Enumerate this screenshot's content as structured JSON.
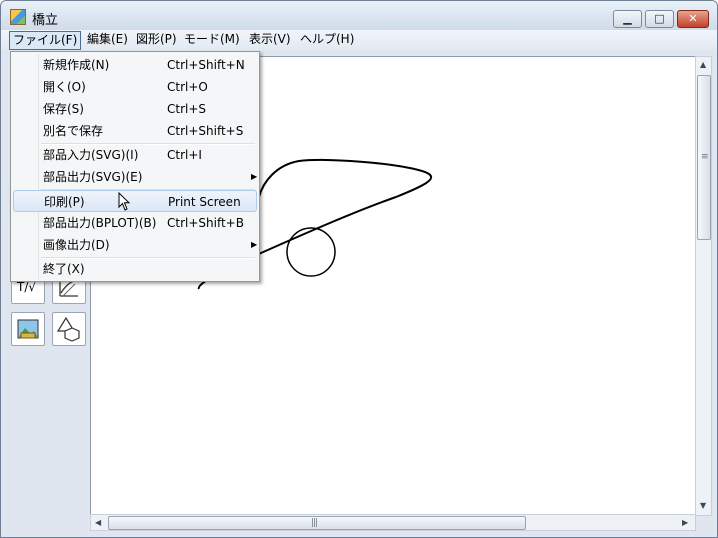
{
  "window": {
    "title": "橋立",
    "controls": {
      "minimize": "▁",
      "maximize": "□",
      "close": "✕"
    }
  },
  "menubar": [
    {
      "label": "ファイル(F)"
    },
    {
      "label": "編集(E)"
    },
    {
      "label": "図形(P)"
    },
    {
      "label": "モード(M)"
    },
    {
      "label": "表示(V)"
    },
    {
      "label": "ヘルプ(H)"
    }
  ],
  "file_menu": {
    "items": [
      {
        "label": "新規作成(N)",
        "shortcut": "Ctrl+Shift+N"
      },
      {
        "label": "開く(O)",
        "shortcut": "Ctrl+O"
      },
      {
        "label": "保存(S)",
        "shortcut": "Ctrl+S"
      },
      {
        "label": "別名で保存",
        "shortcut": "Ctrl+Shift+S"
      },
      {
        "label": "部品入力(SVG)(I)",
        "shortcut": "Ctrl+I"
      },
      {
        "label": "部品出力(SVG)(E)",
        "shortcut": "",
        "submenu": "▶"
      },
      {
        "label": "印刷(P)",
        "shortcut": "Print Screen",
        "highlighted": true
      },
      {
        "label": "部品出力(BPLOT)(B)",
        "shortcut": "Ctrl+Shift+B"
      },
      {
        "label": "画像出力(D)",
        "shortcut": "",
        "submenu": "▶"
      },
      {
        "label": "終了(X)",
        "shortcut": ""
      }
    ]
  },
  "toolbox": {
    "text_math_tool": {
      "label": "T/√",
      "icon": "text-math-icon"
    },
    "graph_tool": {
      "icon": "graph-icon"
    },
    "image_tool": {
      "icon": "image-icon"
    },
    "shapes_tool": {
      "icon": "shapes-icon"
    }
  },
  "scrollbar": {
    "grip": "|||"
  },
  "colors": {
    "selection": "#dbe8f7",
    "window_frame": "#dfe6ef",
    "close_button": "#c4412b"
  }
}
